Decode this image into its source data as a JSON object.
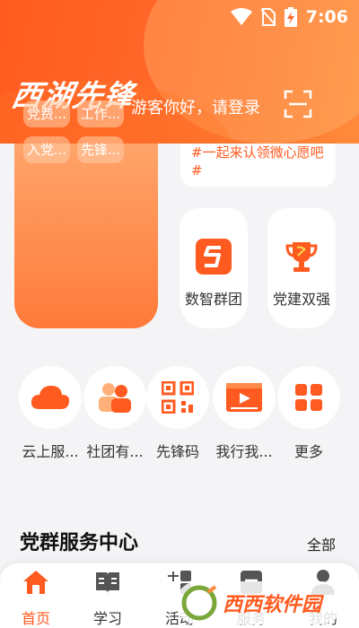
{
  "status_bar": {
    "time": "7:06"
  },
  "header": {
    "logo_text": "西湖先锋",
    "greeting": "游客你好，请登录"
  },
  "banner": {
    "chips": [
      "党费...",
      "工作...",
      "入党...",
      "先锋..."
    ],
    "topic": "#一起来认领微心愿吧#",
    "tiles": [
      {
        "label": "数智群团",
        "icon": "s-logo-icon"
      },
      {
        "label": "党建双强",
        "icon": "trophy-icon"
      }
    ]
  },
  "services": [
    {
      "label": "云上服...",
      "icon": "cloud-icon"
    },
    {
      "label": "社团有...",
      "icon": "people-icon"
    },
    {
      "label": "先锋码",
      "icon": "qr-code-icon"
    },
    {
      "label": "我行我...",
      "icon": "video-icon"
    },
    {
      "label": "更多",
      "icon": "grid-icon"
    }
  ],
  "section": {
    "title": "党群服务中心",
    "more": "全部"
  },
  "tabs": [
    {
      "label": "首页",
      "icon": "home-icon",
      "active": true
    },
    {
      "label": "学习",
      "icon": "book-icon"
    },
    {
      "label": "活动",
      "icon": "activity-icon"
    },
    {
      "label": "服务",
      "icon": "service-icon"
    },
    {
      "label": "我的",
      "icon": "person-icon"
    }
  ],
  "watermark": {
    "text": "西西软件园"
  },
  "colors": {
    "accent": "#ff5a1f",
    "accent_light": "#ffa46a",
    "background": "#f4f4f6"
  }
}
